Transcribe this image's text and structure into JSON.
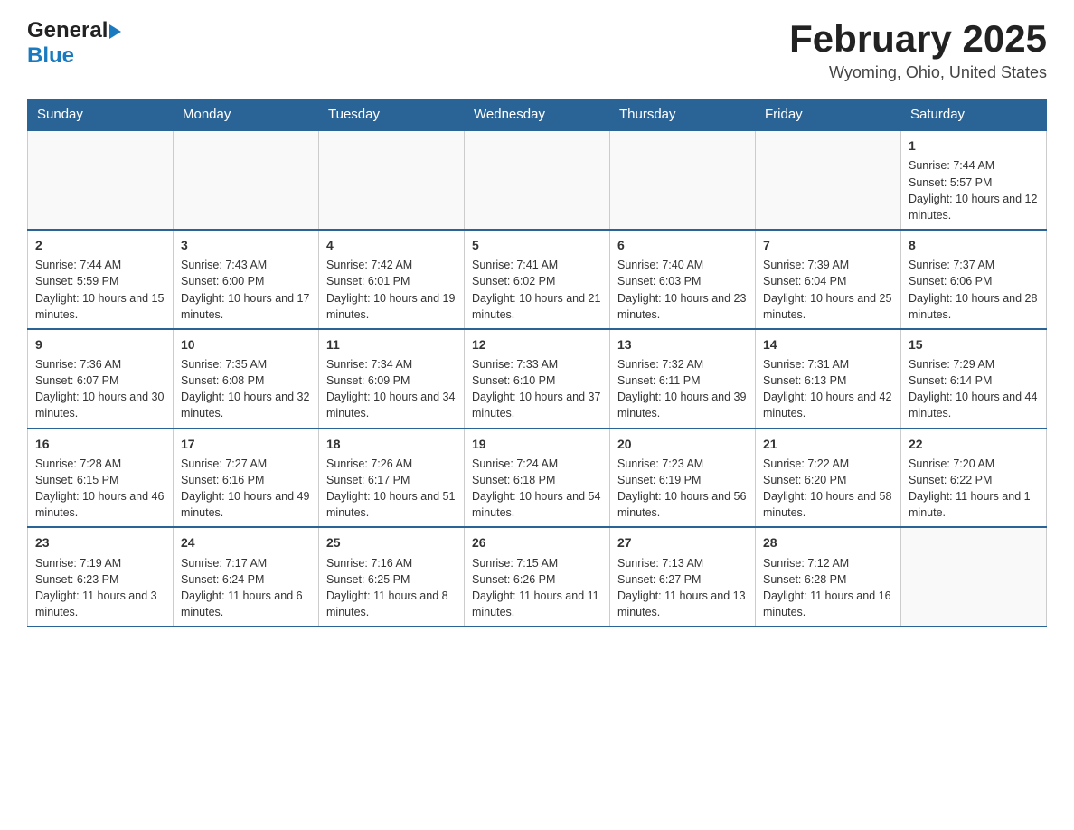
{
  "header": {
    "logo_general": "General",
    "logo_blue": "Blue",
    "title": "February 2025",
    "subtitle": "Wyoming, Ohio, United States"
  },
  "days_of_week": [
    "Sunday",
    "Monday",
    "Tuesday",
    "Wednesday",
    "Thursday",
    "Friday",
    "Saturday"
  ],
  "weeks": [
    {
      "days": [
        {
          "number": "",
          "sunrise": "",
          "sunset": "",
          "daylight": "",
          "empty": true
        },
        {
          "number": "",
          "sunrise": "",
          "sunset": "",
          "daylight": "",
          "empty": true
        },
        {
          "number": "",
          "sunrise": "",
          "sunset": "",
          "daylight": "",
          "empty": true
        },
        {
          "number": "",
          "sunrise": "",
          "sunset": "",
          "daylight": "",
          "empty": true
        },
        {
          "number": "",
          "sunrise": "",
          "sunset": "",
          "daylight": "",
          "empty": true
        },
        {
          "number": "",
          "sunrise": "",
          "sunset": "",
          "daylight": "",
          "empty": true
        },
        {
          "number": "1",
          "sunrise": "Sunrise: 7:44 AM",
          "sunset": "Sunset: 5:57 PM",
          "daylight": "Daylight: 10 hours and 12 minutes.",
          "empty": false
        }
      ]
    },
    {
      "days": [
        {
          "number": "2",
          "sunrise": "Sunrise: 7:44 AM",
          "sunset": "Sunset: 5:59 PM",
          "daylight": "Daylight: 10 hours and 15 minutes.",
          "empty": false
        },
        {
          "number": "3",
          "sunrise": "Sunrise: 7:43 AM",
          "sunset": "Sunset: 6:00 PM",
          "daylight": "Daylight: 10 hours and 17 minutes.",
          "empty": false
        },
        {
          "number": "4",
          "sunrise": "Sunrise: 7:42 AM",
          "sunset": "Sunset: 6:01 PM",
          "daylight": "Daylight: 10 hours and 19 minutes.",
          "empty": false
        },
        {
          "number": "5",
          "sunrise": "Sunrise: 7:41 AM",
          "sunset": "Sunset: 6:02 PM",
          "daylight": "Daylight: 10 hours and 21 minutes.",
          "empty": false
        },
        {
          "number": "6",
          "sunrise": "Sunrise: 7:40 AM",
          "sunset": "Sunset: 6:03 PM",
          "daylight": "Daylight: 10 hours and 23 minutes.",
          "empty": false
        },
        {
          "number": "7",
          "sunrise": "Sunrise: 7:39 AM",
          "sunset": "Sunset: 6:04 PM",
          "daylight": "Daylight: 10 hours and 25 minutes.",
          "empty": false
        },
        {
          "number": "8",
          "sunrise": "Sunrise: 7:37 AM",
          "sunset": "Sunset: 6:06 PM",
          "daylight": "Daylight: 10 hours and 28 minutes.",
          "empty": false
        }
      ]
    },
    {
      "days": [
        {
          "number": "9",
          "sunrise": "Sunrise: 7:36 AM",
          "sunset": "Sunset: 6:07 PM",
          "daylight": "Daylight: 10 hours and 30 minutes.",
          "empty": false
        },
        {
          "number": "10",
          "sunrise": "Sunrise: 7:35 AM",
          "sunset": "Sunset: 6:08 PM",
          "daylight": "Daylight: 10 hours and 32 minutes.",
          "empty": false
        },
        {
          "number": "11",
          "sunrise": "Sunrise: 7:34 AM",
          "sunset": "Sunset: 6:09 PM",
          "daylight": "Daylight: 10 hours and 34 minutes.",
          "empty": false
        },
        {
          "number": "12",
          "sunrise": "Sunrise: 7:33 AM",
          "sunset": "Sunset: 6:10 PM",
          "daylight": "Daylight: 10 hours and 37 minutes.",
          "empty": false
        },
        {
          "number": "13",
          "sunrise": "Sunrise: 7:32 AM",
          "sunset": "Sunset: 6:11 PM",
          "daylight": "Daylight: 10 hours and 39 minutes.",
          "empty": false
        },
        {
          "number": "14",
          "sunrise": "Sunrise: 7:31 AM",
          "sunset": "Sunset: 6:13 PM",
          "daylight": "Daylight: 10 hours and 42 minutes.",
          "empty": false
        },
        {
          "number": "15",
          "sunrise": "Sunrise: 7:29 AM",
          "sunset": "Sunset: 6:14 PM",
          "daylight": "Daylight: 10 hours and 44 minutes.",
          "empty": false
        }
      ]
    },
    {
      "days": [
        {
          "number": "16",
          "sunrise": "Sunrise: 7:28 AM",
          "sunset": "Sunset: 6:15 PM",
          "daylight": "Daylight: 10 hours and 46 minutes.",
          "empty": false
        },
        {
          "number": "17",
          "sunrise": "Sunrise: 7:27 AM",
          "sunset": "Sunset: 6:16 PM",
          "daylight": "Daylight: 10 hours and 49 minutes.",
          "empty": false
        },
        {
          "number": "18",
          "sunrise": "Sunrise: 7:26 AM",
          "sunset": "Sunset: 6:17 PM",
          "daylight": "Daylight: 10 hours and 51 minutes.",
          "empty": false
        },
        {
          "number": "19",
          "sunrise": "Sunrise: 7:24 AM",
          "sunset": "Sunset: 6:18 PM",
          "daylight": "Daylight: 10 hours and 54 minutes.",
          "empty": false
        },
        {
          "number": "20",
          "sunrise": "Sunrise: 7:23 AM",
          "sunset": "Sunset: 6:19 PM",
          "daylight": "Daylight: 10 hours and 56 minutes.",
          "empty": false
        },
        {
          "number": "21",
          "sunrise": "Sunrise: 7:22 AM",
          "sunset": "Sunset: 6:20 PM",
          "daylight": "Daylight: 10 hours and 58 minutes.",
          "empty": false
        },
        {
          "number": "22",
          "sunrise": "Sunrise: 7:20 AM",
          "sunset": "Sunset: 6:22 PM",
          "daylight": "Daylight: 11 hours and 1 minute.",
          "empty": false
        }
      ]
    },
    {
      "days": [
        {
          "number": "23",
          "sunrise": "Sunrise: 7:19 AM",
          "sunset": "Sunset: 6:23 PM",
          "daylight": "Daylight: 11 hours and 3 minutes.",
          "empty": false
        },
        {
          "number": "24",
          "sunrise": "Sunrise: 7:17 AM",
          "sunset": "Sunset: 6:24 PM",
          "daylight": "Daylight: 11 hours and 6 minutes.",
          "empty": false
        },
        {
          "number": "25",
          "sunrise": "Sunrise: 7:16 AM",
          "sunset": "Sunset: 6:25 PM",
          "daylight": "Daylight: 11 hours and 8 minutes.",
          "empty": false
        },
        {
          "number": "26",
          "sunrise": "Sunrise: 7:15 AM",
          "sunset": "Sunset: 6:26 PM",
          "daylight": "Daylight: 11 hours and 11 minutes.",
          "empty": false
        },
        {
          "number": "27",
          "sunrise": "Sunrise: 7:13 AM",
          "sunset": "Sunset: 6:27 PM",
          "daylight": "Daylight: 11 hours and 13 minutes.",
          "empty": false
        },
        {
          "number": "28",
          "sunrise": "Sunrise: 7:12 AM",
          "sunset": "Sunset: 6:28 PM",
          "daylight": "Daylight: 11 hours and 16 minutes.",
          "empty": false
        },
        {
          "number": "",
          "sunrise": "",
          "sunset": "",
          "daylight": "",
          "empty": true
        }
      ]
    }
  ]
}
